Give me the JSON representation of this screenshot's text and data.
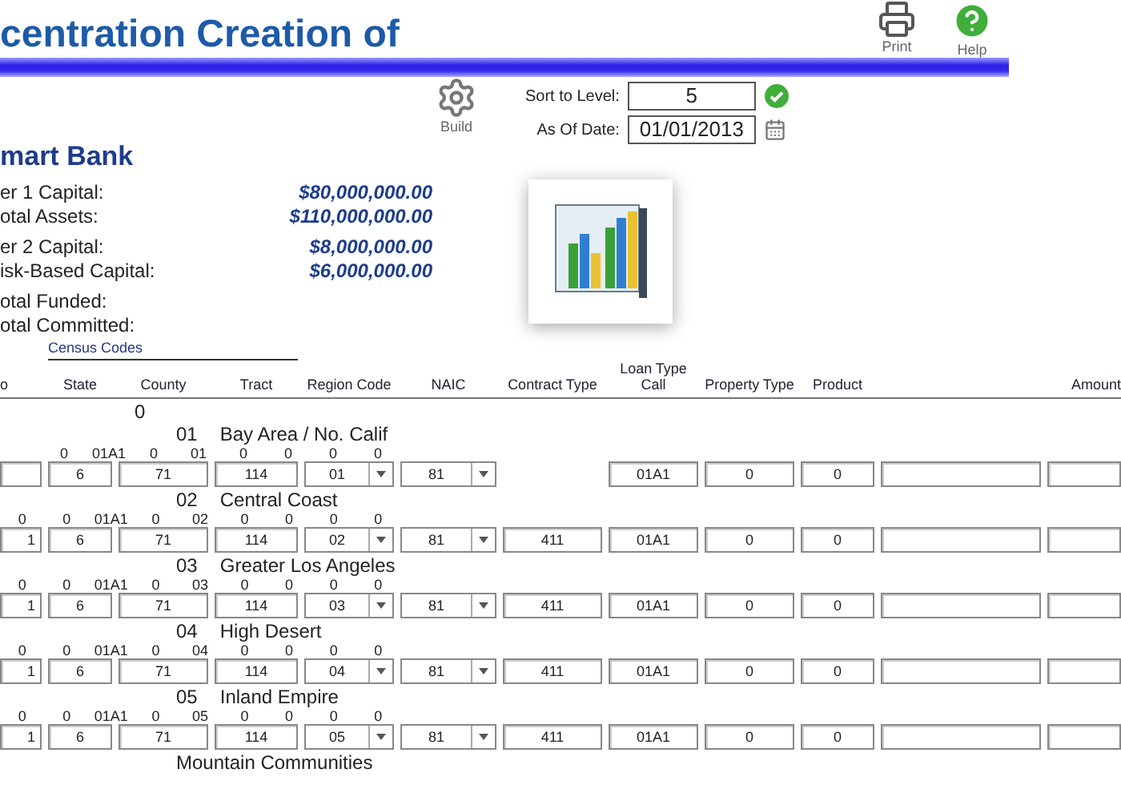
{
  "title": "centration Creation of",
  "toolbar": {
    "build": "Build",
    "sort_level": {
      "label": "Sort to Level:",
      "value": "5"
    },
    "as_of_date": {
      "label": "As Of Date:",
      "value": "01/01/2013"
    },
    "print": "Print",
    "help": "Help"
  },
  "bank": {
    "name": "mart Bank",
    "figure_groups": [
      [
        {
          "label": "er 1 Capital:",
          "value": "$80,000,000.00"
        },
        {
          "label": "otal Assets:",
          "value": "$110,000,000.00"
        }
      ],
      [
        {
          "label": "er 2 Capital:",
          "value": "$8,000,000.00"
        },
        {
          "label": "isk-Based Capital:",
          "value": "$6,000,000.00"
        }
      ],
      [
        {
          "label": "otal Funded:"
        },
        {
          "label": "otal Committed:"
        }
      ]
    ]
  },
  "columns": {
    "lead": "o",
    "group": "Census Codes",
    "items": [
      "State",
      "County",
      "Tract",
      "Region Code",
      "NAIC",
      "Contract Type",
      "Loan Type Call",
      "Property Type",
      "Product",
      "Amount"
    ]
  },
  "top_code": "0",
  "rows": [
    {
      "code": "01",
      "name": "Bay Area / No. Calif",
      "marks": [
        "0",
        "01A1",
        "0",
        "01",
        "0",
        "0",
        "0",
        "0"
      ],
      "state": "6",
      "county": "71",
      "tract": "114",
      "region": "01",
      "naics": "81",
      "loan_type": "01A1",
      "property_type": "0",
      "product": "0"
    },
    {
      "code": "02",
      "name": "Central Coast",
      "lead": "1",
      "marks": [
        "0",
        "0",
        "01A1",
        "0",
        "02",
        "0",
        "0",
        "0",
        "0"
      ],
      "state": "6",
      "county": "71",
      "tract": "114",
      "region": "02",
      "naics": "81",
      "contract_type": "411",
      "loan_type": "01A1",
      "property_type": "0",
      "product": "0"
    },
    {
      "code": "03",
      "name": "Greater Los Angeles",
      "lead": "1",
      "marks": [
        "0",
        "0",
        "01A1",
        "0",
        "03",
        "0",
        "0",
        "0",
        "0"
      ],
      "state": "6",
      "county": "71",
      "tract": "114",
      "region": "03",
      "naics": "81",
      "contract_type": "411",
      "loan_type": "01A1",
      "property_type": "0",
      "product": "0"
    },
    {
      "code": "04",
      "name": "High Desert",
      "lead": "1",
      "marks": [
        "0",
        "0",
        "01A1",
        "0",
        "04",
        "0",
        "0",
        "0",
        "0"
      ],
      "state": "6",
      "county": "71",
      "tract": "114",
      "region": "04",
      "naics": "81",
      "contract_type": "411",
      "loan_type": "01A1",
      "property_type": "0",
      "product": "0"
    },
    {
      "code": "05",
      "name": "Inland Empire",
      "lead": "1",
      "marks": [
        "0",
        "0",
        "01A1",
        "0",
        "05",
        "0",
        "0",
        "0",
        "0"
      ],
      "state": "6",
      "county": "71",
      "tract": "114",
      "region": "05",
      "naics": "81",
      "contract_type": "411",
      "loan_type": "01A1",
      "property_type": "0",
      "product": "0"
    },
    {
      "name": "Mountain Communities"
    }
  ]
}
